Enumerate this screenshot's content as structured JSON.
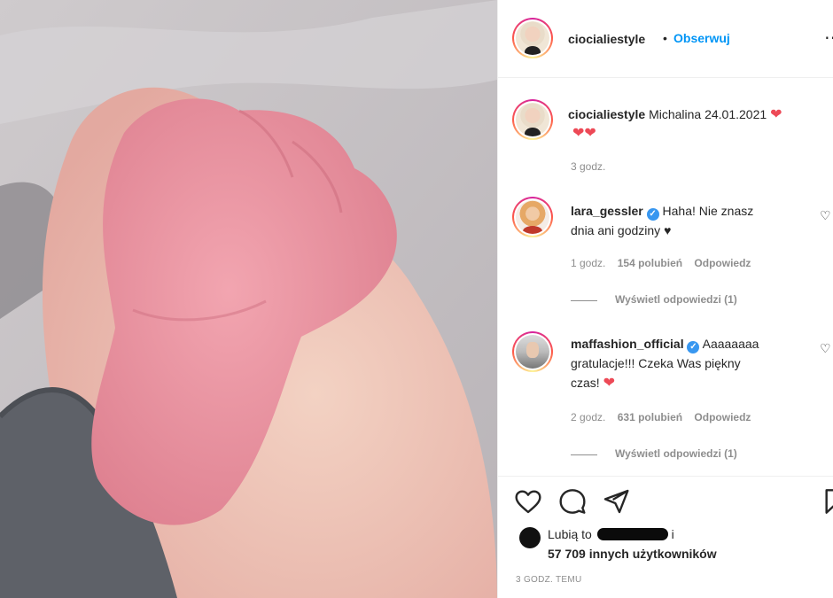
{
  "post": {
    "author": "ciocialiestyle",
    "follow_separator": "•",
    "follow_label": "Obserwuj",
    "more_label": "…",
    "caption": {
      "username": "ciocialiestyle",
      "text": "Michalina 24.01.2021",
      "hearts_line2": "❤❤",
      "time": "3 godz."
    }
  },
  "comments": [
    {
      "username": "lara_gessler",
      "verified": true,
      "text_line1": "Haha! Nie znasz",
      "text_line2": "dnia ani godziny ♥",
      "time": "1 godz.",
      "likes": "154 polubień",
      "reply_label": "Odpowiedz",
      "view_replies": "Wyświetl odpowiedzi (1)"
    },
    {
      "username": "maffashion_official",
      "verified": true,
      "text_line1": "Aaaaaaaa",
      "text_line2": "gratulacje!!! Czeka Was piękny",
      "text_line3": "czas!",
      "time": "2 godz.",
      "likes": "631 polubień",
      "reply_label": "Odpowiedz",
      "view_replies": "Wyświetl odpowiedzi (1)"
    }
  ],
  "likes": {
    "prefix": "Lubią to",
    "suffix": "i",
    "count_line": "57 709 innych użytkowników"
  },
  "posted_ago": "3 godz. temu",
  "icons": [
    "heart-icon",
    "comment-icon",
    "share-icon",
    "bookmark-icon",
    "more-icon",
    "verified-icon"
  ],
  "colors": {
    "link_blue": "#0095f6",
    "heart_red": "#ed4956",
    "muted_text": "#8e8e8e",
    "border": "#efefef"
  }
}
